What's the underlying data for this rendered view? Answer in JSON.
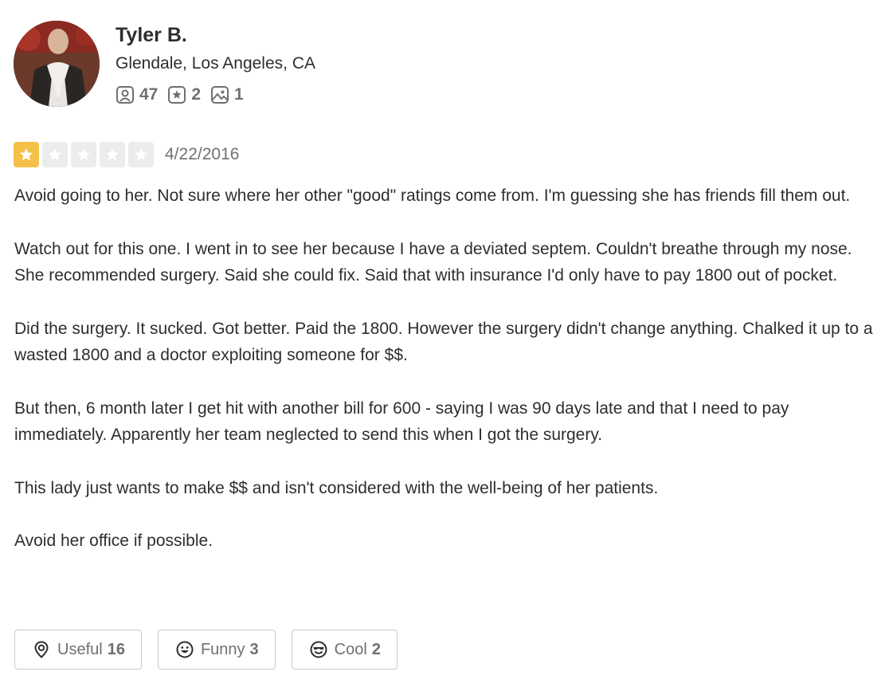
{
  "reviewer": {
    "name": "Tyler B.",
    "location": "Glendale, Los Angeles, CA",
    "stats": {
      "friends": "47",
      "reviews": "2",
      "photos": "1"
    }
  },
  "rating": {
    "stars": 1,
    "max_stars": 5,
    "date": "4/22/2016"
  },
  "review": {
    "paragraphs": [
      "Avoid going to her. Not sure where her other \"good\" ratings come from. I'm guessing she has friends fill them out.",
      "Watch out for this one. I went in to see her because I have a deviated septem. Couldn't breathe through my nose. She recommended surgery. Said she could fix. Said that with insurance I'd only have to pay 1800 out of pocket.",
      "Did the surgery. It sucked. Got better. Paid the 1800. However the surgery didn't change anything. Chalked it up to a wasted 1800 and a doctor exploiting someone for $$.",
      "But then, 6 month later I get hit with another bill for 600 - saying I was 90 days late and that I need to pay immediately. Apparently her team neglected to send this when I got the surgery.",
      "This lady just wants to make $$ and isn't considered with the well-being of her patients.",
      "Avoid her office if possible."
    ]
  },
  "reactions": {
    "useful": {
      "label": "Useful",
      "count": "16"
    },
    "funny": {
      "label": "Funny",
      "count": "3"
    },
    "cool": {
      "label": "Cool",
      "count": "2"
    }
  },
  "colors": {
    "star_active": "#f5c04a",
    "star_inactive": "#ececec",
    "text_primary": "#2d2e2f",
    "text_secondary": "#6e7072"
  },
  "icons": {
    "friends": "friends-icon",
    "reviews": "star-review-icon",
    "photos": "photo-icon",
    "useful": "useful-icon",
    "funny": "funny-icon",
    "cool": "cool-icon"
  }
}
